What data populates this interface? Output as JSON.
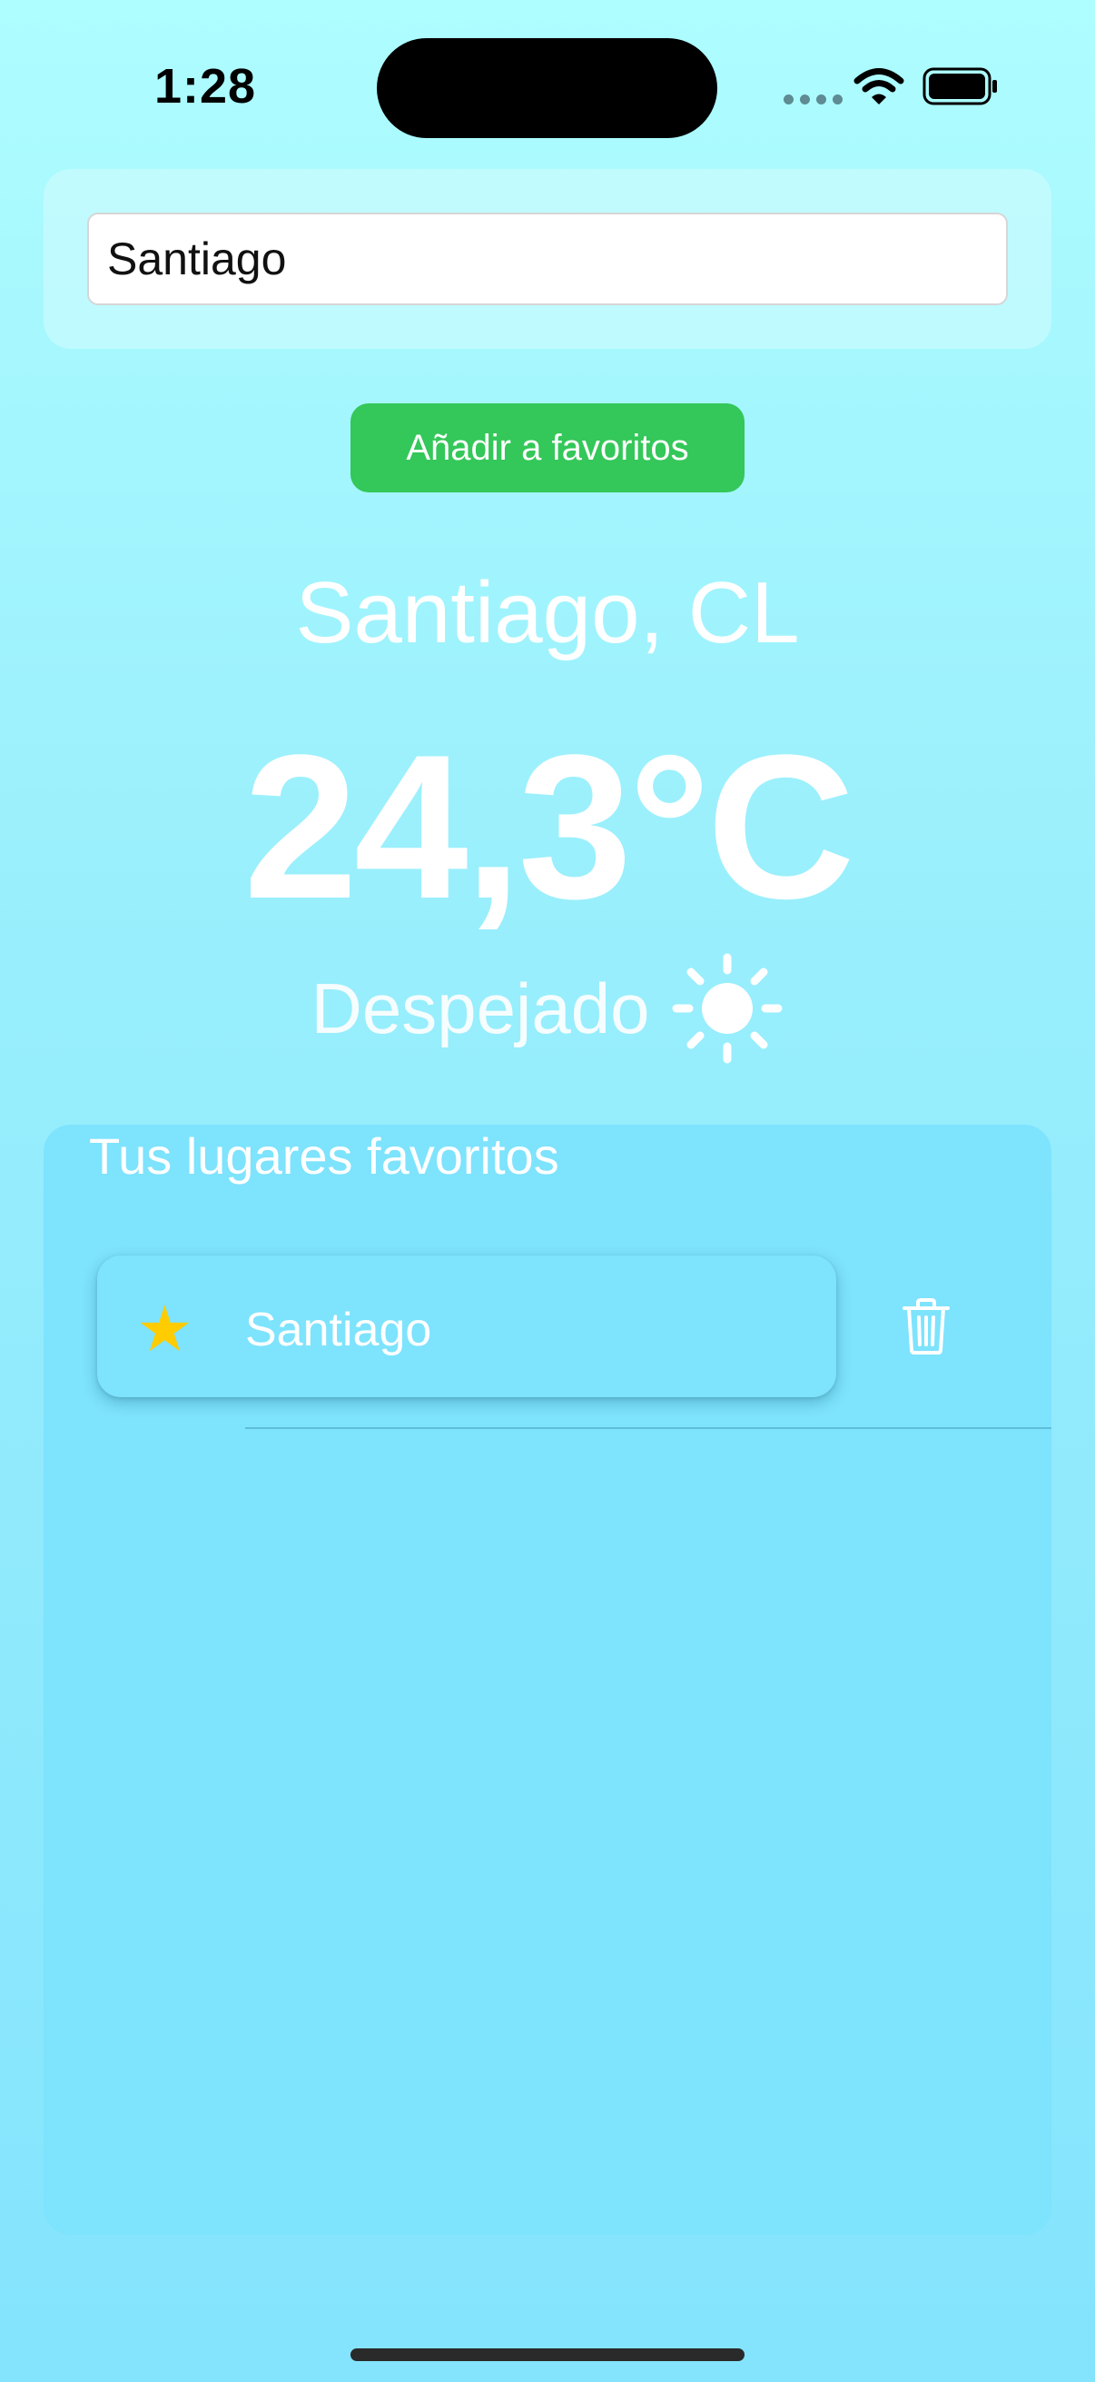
{
  "status_bar": {
    "time": "1:28",
    "icons": [
      "signal-dots-icon",
      "wifi-icon",
      "battery-icon"
    ]
  },
  "search": {
    "value": "Santiago"
  },
  "actions": {
    "add_favorite_label": "Añadir a favoritos",
    "add_favorite_color": "#34c759"
  },
  "weather": {
    "location": "Santiago, CL",
    "temperature": "24,3°C",
    "condition": "Despejado",
    "condition_icon": "sun-icon"
  },
  "favorites": {
    "title": "Tus lugares favoritos",
    "items": [
      {
        "label": "Santiago",
        "icon": "star-icon",
        "star_color": "#ffcc00",
        "delete_icon": "trash-icon"
      }
    ]
  }
}
